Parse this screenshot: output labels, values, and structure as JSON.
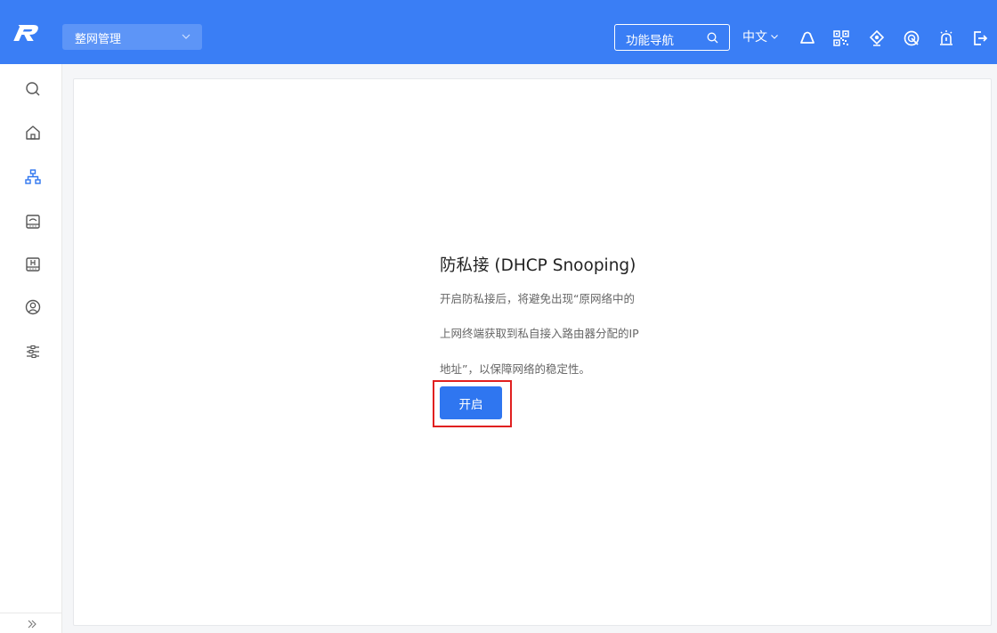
{
  "header": {
    "scope_select": "整网管理",
    "feature_nav_label": "功能导航",
    "language": "中文"
  },
  "header_icons": [
    "cloud-icon",
    "qr-code-icon",
    "alert-icon",
    "network-diag-icon",
    "alarm-icon",
    "logout-icon"
  ],
  "sidebar": {
    "items": [
      "search-icon",
      "home-icon",
      "topology-icon",
      "router-icon",
      "device-icon",
      "user-icon",
      "settings-sliders-icon"
    ],
    "collapse_label": "»"
  },
  "content": {
    "title": "防私接 (DHCP Snooping)",
    "description_lines": [
      "开启防私接后，将避免出现“原网络中的",
      "上网终端获取到私自接入路由器分配的IP",
      "地址”，以保障网络的稳定性。"
    ],
    "enable_button": "开启"
  },
  "colors": {
    "header_bg": "#3a7ef5",
    "primary_button": "#2f76f0",
    "highlight_border": "#e02020",
    "sidebar_icon_active": "#2f76f0"
  }
}
